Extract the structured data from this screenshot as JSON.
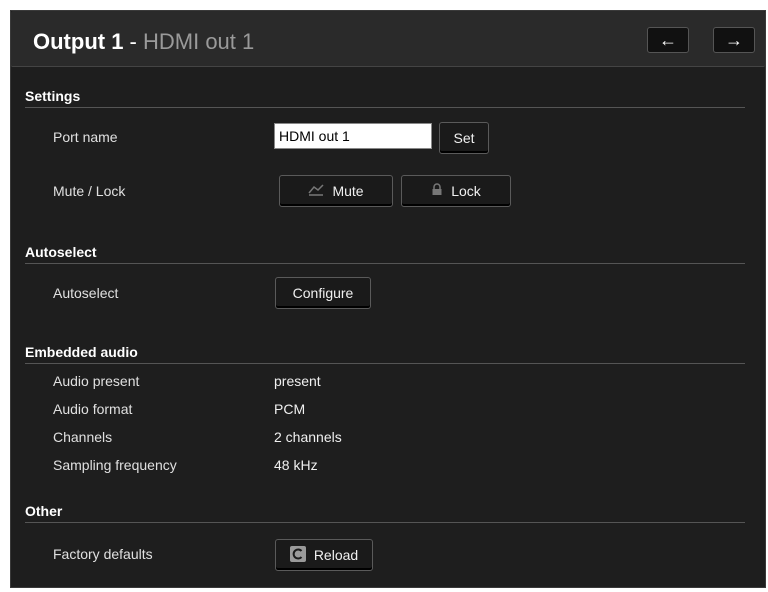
{
  "header": {
    "title_bold": "Output 1",
    "title_sep": " - ",
    "title_sub": "HDMI out 1",
    "prev_icon": "←",
    "next_icon": "→"
  },
  "settings": {
    "title": "Settings",
    "port_name_label": "Port name",
    "port_name_value": "HDMI out 1",
    "set_label": "Set",
    "mute_lock_label": "Mute / Lock",
    "mute_label": "Mute",
    "lock_label": "Lock"
  },
  "autoselect": {
    "title": "Autoselect",
    "label": "Autoselect",
    "configure_label": "Configure"
  },
  "embedded_audio": {
    "title": "Embedded audio",
    "rows": [
      {
        "label": "Audio present",
        "value": "present"
      },
      {
        "label": "Audio format",
        "value": "PCM"
      },
      {
        "label": "Channels",
        "value": "2 channels"
      },
      {
        "label": "Sampling frequency",
        "value": "48 kHz"
      }
    ]
  },
  "other": {
    "title": "Other",
    "factory_label": "Factory defaults",
    "reload_label": "Reload"
  },
  "icons": {
    "prev": "arrow-left-icon",
    "next": "arrow-right-icon",
    "mute": "mute-icon",
    "lock": "lock-icon",
    "reload": "reload-icon"
  }
}
